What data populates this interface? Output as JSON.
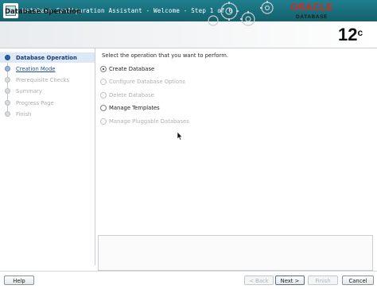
{
  "window": {
    "title": "Database Configuration Assistant - Welcome - Step 1 of 6"
  },
  "header": {
    "page_title": "Database Operation",
    "brand": "ORACLE",
    "brand_sub": "DATABASE",
    "version": "12",
    "version_suffix": "c"
  },
  "sidebar": {
    "steps": [
      {
        "label": "Database Operation",
        "state": "active"
      },
      {
        "label": "Creation Mode",
        "state": "link"
      },
      {
        "label": "Prerequisite Checks",
        "state": "disabled"
      },
      {
        "label": "Summary",
        "state": "disabled"
      },
      {
        "label": "Progress Page",
        "state": "disabled"
      },
      {
        "label": "Finish",
        "state": "disabled"
      }
    ]
  },
  "main": {
    "instruction": "Select the operation that you want to perform.",
    "options": [
      {
        "label": "Create Database",
        "selected": true,
        "enabled": true
      },
      {
        "label": "Configure Database Options",
        "selected": false,
        "enabled": false
      },
      {
        "label": "Delete Database",
        "selected": false,
        "enabled": false
      },
      {
        "label": "Manage Templates",
        "selected": false,
        "enabled": true
      },
      {
        "label": "Manage Pluggable Databases",
        "selected": false,
        "enabled": false
      }
    ]
  },
  "buttons": {
    "help": "Help",
    "back": "< Back",
    "next": "Next >",
    "finish": "Finish",
    "cancel": "Cancel"
  },
  "colors": {
    "titlebar": "#1f7f8e",
    "brand_red": "#e2231a",
    "active_step": "#dde8f7"
  }
}
